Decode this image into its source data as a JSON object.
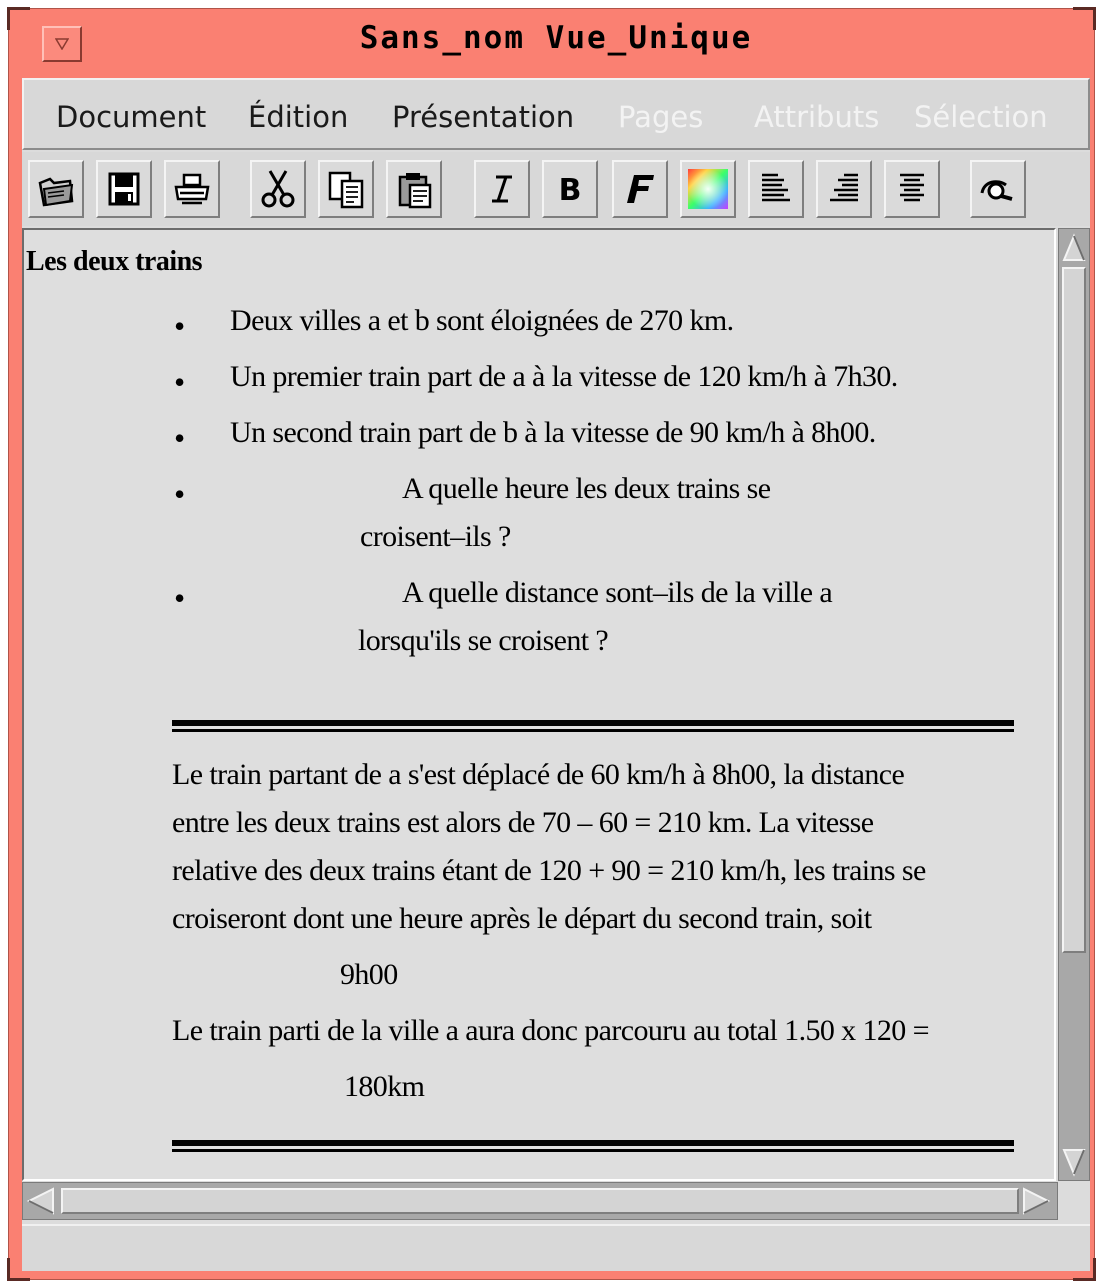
{
  "window": {
    "title": "Sans_nom  Vue_Unique"
  },
  "menubar": {
    "items": [
      {
        "label": "Document",
        "enabled": true
      },
      {
        "label": "Édition",
        "enabled": true
      },
      {
        "label": "Présentation",
        "enabled": true
      },
      {
        "label": "Pages",
        "enabled": false
      },
      {
        "label": "Attributs",
        "enabled": false
      },
      {
        "label": "Sélection",
        "enabled": false
      }
    ]
  },
  "toolbar": {
    "buttons": [
      "open-icon",
      "save-icon",
      "print-icon",
      "cut-icon",
      "copy-icon",
      "paste-icon",
      "italic-icon",
      "bold-icon",
      "font-icon",
      "color-palette-icon",
      "align-left-icon",
      "align-right-icon",
      "align-center-icon",
      "search-icon"
    ]
  },
  "document": {
    "heading": "Les deux trains",
    "bullets": [
      "Deux villes a et b sont éloignées de 270 km.",
      "Un premier train part de a à la vitesse de 120 km/h à 7h30.",
      "Un second train part de b à la vitesse de 90 km/h à 8h00.",
      "A quelle heure les deux trains se",
      "croisent–ils ?",
      "A quelle distance sont–ils de la ville a",
      "lorsqu'ils se croisent ?"
    ],
    "answer_lines": [
      "Le train partant de a s'est déplacé de 60 km/h à 8h00, la distance",
      "entre les deux trains est alors de 70 – 60 = 210 km. La vitesse",
      "relative des deux trains étant de 120 + 90 = 210 km/h, les trains se",
      "croiseront dont une heure après le départ du second train, soit",
      "9h00",
      "Le train parti de la ville a aura donc parcouru au total 1.50 x 120 =",
      "180km"
    ]
  }
}
